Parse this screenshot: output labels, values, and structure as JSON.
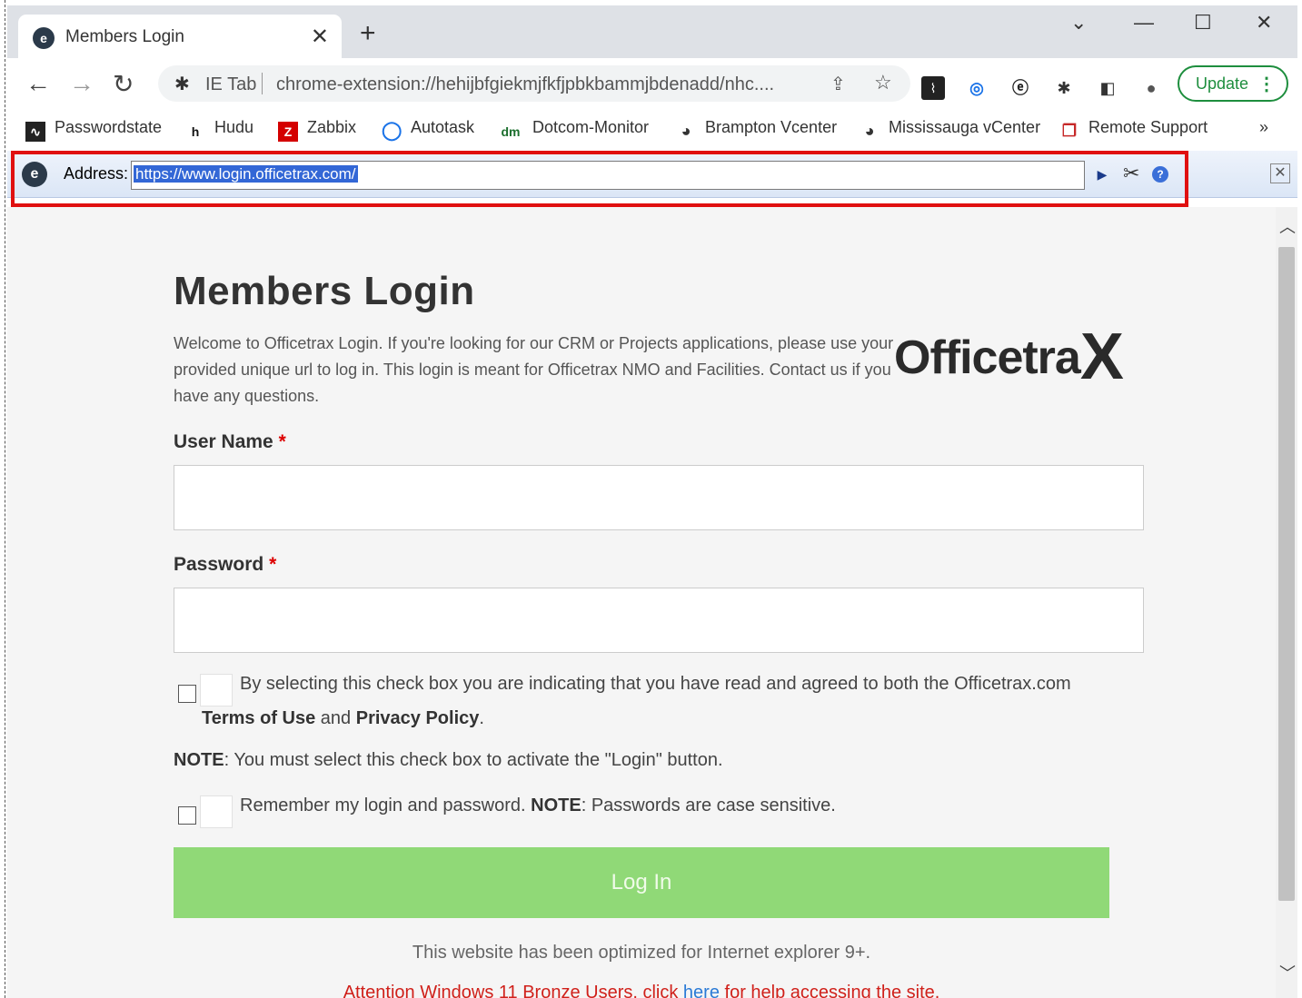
{
  "browser": {
    "tab_title": "Members Login",
    "tab_close": "✕",
    "new_tab": "+",
    "omnibox": {
      "extension_label": "IE Tab",
      "url": "chrome-extension://hehijbfgiekmjfkfjpbkbammjbdenadd/nhc...."
    },
    "update_label": "Update",
    "bookmarks": [
      {
        "label": "Passwordstate",
        "icon": "passwordstate-icon"
      },
      {
        "label": "Hudu",
        "icon": "hudu-icon"
      },
      {
        "label": "Zabbix",
        "icon": "zabbix-icon"
      },
      {
        "label": "Autotask",
        "icon": "autotask-icon"
      },
      {
        "label": "Dotcom-Monitor",
        "icon": "dotcom-monitor-icon"
      },
      {
        "label": "Brampton Vcenter",
        "icon": "globe-icon"
      },
      {
        "label": "Mississauga vCenter",
        "icon": "globe-icon"
      },
      {
        "label": "Remote Support",
        "icon": "remote-support-icon"
      }
    ],
    "bookmarks_more": "»"
  },
  "ietab": {
    "address_label": "Address:",
    "address_value": "https://www.login.officetrax.com/"
  },
  "page": {
    "title": "Members Login",
    "welcome": "Welcome to Officetrax Login. If you're looking for our CRM or Projects applications, please use your provided unique url to log in. This login is meant for Officetrax NMO and Facilities. Contact us if you have any questions.",
    "logo_text": "Officetra",
    "logo_x": "X",
    "username_label": "User Name",
    "password_label": "Password",
    "required_mark": "*",
    "terms_text": "By selecting this check box you are indicating that you have read and agreed to both the Officetrax.com",
    "terms_of_use": "Terms of Use",
    "and": "and",
    "privacy_policy": "Privacy Policy",
    "period": ".",
    "note_label": "NOTE",
    "note_text": ": You must select this check box to activate the \"Login\" button.",
    "remember_text": "Remember my login and password.",
    "remember_note_label": "NOTE",
    "remember_note_text": ": Passwords are case sensitive.",
    "login_button": "Log In",
    "optimized_text": "This website has been optimized for Internet explorer 9+.",
    "attention_prefix": "Attention Windows 11 Bronze Users, click",
    "attention_link": "here",
    "attention_suffix": "for help accessing the site."
  },
  "colors": {
    "login_button": "#90d977",
    "highlight_box": "#e01010",
    "attention": "#d0201a",
    "link": "#2b7bd6"
  }
}
